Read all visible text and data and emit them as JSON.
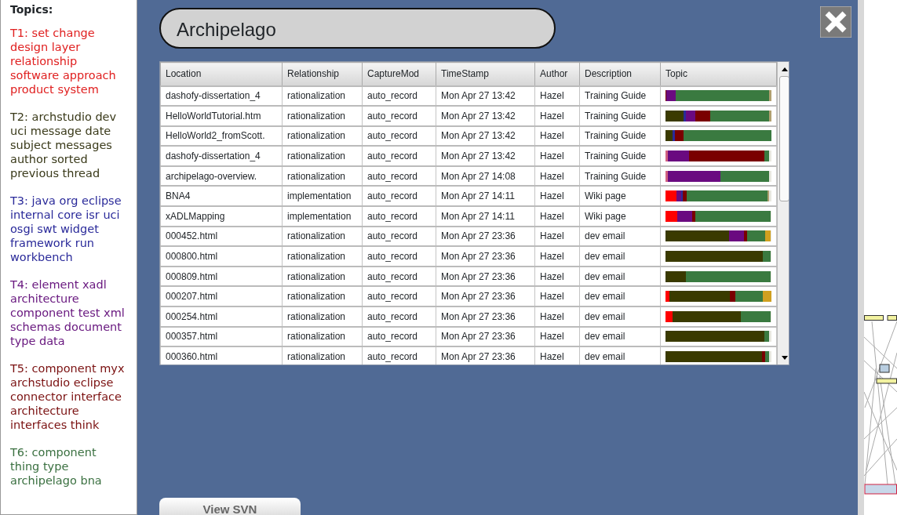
{
  "sidebar": {
    "heading": "Topics:",
    "topics": [
      {
        "text": "T1: set change design layer relationship software approach product system",
        "color": "#e02020"
      },
      {
        "text": "T2: archstudio dev uci message date subject messages author sorted previous thread",
        "color": "#3a3a1a"
      },
      {
        "text": "T3: java org eclipse internal core isr uci osgi swt widget framework run workbench",
        "color": "#2a2a9a"
      },
      {
        "text": "T4: element xadl architecture component test xml schemas document type data",
        "color": "#6a1a80"
      },
      {
        "text": "T5: component myx archstudio eclipse connector interface architecture interfaces think",
        "color": "#7a1010"
      },
      {
        "text": "T6: component thing type archipelago bna",
        "color": "#3a7040"
      }
    ]
  },
  "panel": {
    "title": "Archipelago",
    "button": "View SVN"
  },
  "table": {
    "columns": [
      "Location",
      "Relationship",
      "CaptureMod",
      "TimeStamp",
      "Author",
      "Description",
      "Topic"
    ],
    "rows": [
      {
        "location": "dashofy-dissertation_4",
        "relationship": "rationalization",
        "capture_mode": "auto_record",
        "timestamp": "Mon Apr 27 13:42",
        "author": "Hazel",
        "description": "Training Guide",
        "topic": [
          {
            "color": "#7a0000"
          },
          {
            "color": "#6a0a80"
          },
          {
            "color": "#3a7a40"
          },
          {
            "color": "#b0a070"
          }
        ]
      },
      {
        "location": "HelloWorldTutorial.htm",
        "relationship": "rationalization",
        "capture_mode": "auto_record",
        "timestamp": "Mon Apr 27 13:42",
        "author": "Hazel",
        "description": "Training Guide",
        "topic": [
          {
            "color": "#3a3a00"
          },
          {
            "color": "#2a2a9a"
          },
          {
            "color": "#6a0a80"
          },
          {
            "color": "#7a0000"
          },
          {
            "color": "#3a7a40"
          },
          {
            "color": "#b0a070"
          }
        ]
      },
      {
        "location": "HelloWorld2_fromScott.",
        "relationship": "rationalization",
        "capture_mode": "auto_record",
        "timestamp": "Mon Apr 27 13:42",
        "author": "Hazel",
        "description": "Training Guide",
        "topic": [
          {
            "color": "#3a3a00"
          },
          {
            "color": "#2a2a9a"
          },
          {
            "color": "#7a0000"
          },
          {
            "color": "#3a7a40"
          }
        ]
      },
      {
        "location": "dashofy-dissertation_4",
        "relationship": "rationalization",
        "capture_mode": "auto_record",
        "timestamp": "Mon Apr 27 13:42",
        "author": "Hazel",
        "description": "Training Guide",
        "topic": [
          {
            "color": "#d06080"
          },
          {
            "color": "#6a0a80"
          },
          {
            "color": "#7a0000"
          },
          {
            "color": "#3a7a40"
          }
        ]
      },
      {
        "location": "archipelago-overview.",
        "relationship": "rationalization",
        "capture_mode": "auto_record",
        "timestamp": "Mon Apr 27 14:08",
        "author": "Hazel",
        "description": "Training Guide",
        "topic": [
          {
            "color": "#d06080"
          },
          {
            "color": "#6a0a80"
          },
          {
            "color": "#3a7a40"
          }
        ]
      },
      {
        "location": "BNA4",
        "relationship": "implementation",
        "capture_mode": "auto_record",
        "timestamp": "Mon Apr 27 14:11",
        "author": "Hazel",
        "description": "Wiki page",
        "topic": [
          {
            "color": "#ff0000"
          },
          {
            "color": "#6a0a80"
          },
          {
            "color": "#2a2a9a"
          },
          {
            "color": "#7a0000"
          },
          {
            "color": "#3a7a40"
          },
          {
            "color": "#b0a070"
          }
        ]
      },
      {
        "location": "xADLMapping",
        "relationship": "implementation",
        "capture_mode": "auto_record",
        "timestamp": "Mon Apr 27 14:11",
        "author": "Hazel",
        "description": "Wiki page",
        "topic": [
          {
            "color": "#ff0000"
          },
          {
            "color": "#6a0a80"
          },
          {
            "color": "#7a0000"
          },
          {
            "color": "#3a7a40"
          }
        ]
      },
      {
        "location": "000452.html",
        "relationship": "rationalization",
        "capture_mode": "auto_record",
        "timestamp": "Mon Apr 27 23:36",
        "author": "Hazel",
        "description": "dev email",
        "topic": [
          {
            "color": "#3a3a00"
          },
          {
            "color": "#6a0a80"
          },
          {
            "color": "#7a0000"
          },
          {
            "color": "#3a7a40"
          },
          {
            "color": "#d0a020"
          }
        ]
      },
      {
        "location": "000800.html",
        "relationship": "rationalization",
        "capture_mode": "auto_record",
        "timestamp": "Mon Apr 27 23:36",
        "author": "Hazel",
        "description": "dev email",
        "topic": [
          {
            "color": "#3a3a00"
          },
          {
            "color": "#3a7a40"
          }
        ]
      },
      {
        "location": "000809.html",
        "relationship": "rationalization",
        "capture_mode": "auto_record",
        "timestamp": "Mon Apr 27 23:36",
        "author": "Hazel",
        "description": "dev email",
        "topic": [
          {
            "color": "#3a3a00"
          },
          {
            "color": "#3a7a40"
          }
        ]
      },
      {
        "location": "000207.html",
        "relationship": "rationalization",
        "capture_mode": "auto_record",
        "timestamp": "Mon Apr 27 23:36",
        "author": "Hazel",
        "description": "dev email",
        "topic": [
          {
            "color": "#ff0000"
          },
          {
            "color": "#3a3a00"
          },
          {
            "color": "#7a0000"
          },
          {
            "color": "#3a7a40"
          },
          {
            "color": "#d0a020"
          }
        ]
      },
      {
        "location": "000254.html",
        "relationship": "rationalization",
        "capture_mode": "auto_record",
        "timestamp": "Mon Apr 27 23:36",
        "author": "Hazel",
        "description": "dev email",
        "topic": [
          {
            "color": "#ff0000"
          },
          {
            "color": "#3a3a00"
          },
          {
            "color": "#3a7a40"
          }
        ]
      },
      {
        "location": "000357.html",
        "relationship": "rationalization",
        "capture_mode": "auto_record",
        "timestamp": "Mon Apr 27 23:36",
        "author": "Hazel",
        "description": "dev email",
        "topic": [
          {
            "color": "#3a3a00"
          },
          {
            "color": "#3a7a40"
          }
        ]
      },
      {
        "location": "000360.html",
        "relationship": "rationalization",
        "capture_mode": "auto_record",
        "timestamp": "Mon Apr 27 23:36",
        "author": "Hazel",
        "description": "dev email",
        "topic": [
          {
            "color": "#3a3a00"
          },
          {
            "color": "#7a0000"
          },
          {
            "color": "#3a7a40"
          }
        ]
      }
    ]
  }
}
